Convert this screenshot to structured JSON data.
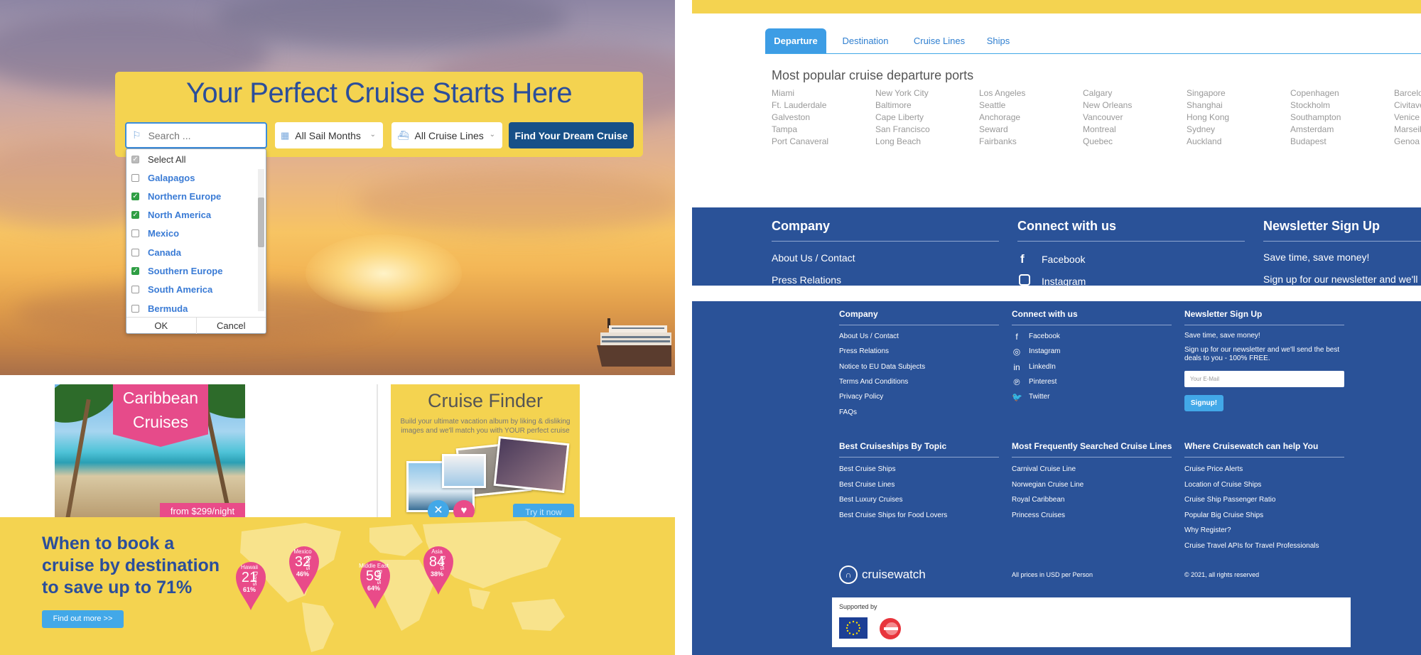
{
  "hero": {
    "title": "Your Perfect Cruise Starts Here",
    "search_placeholder": "Search ...",
    "months_label": "All Sail Months",
    "lines_label": "All Cruise Lines",
    "find_button": "Find Your Dream Cruise"
  },
  "dropdown": {
    "select_all": "Select All",
    "items": [
      {
        "label": "Galapagos",
        "checked": false
      },
      {
        "label": "Northern Europe",
        "checked": true
      },
      {
        "label": "North America",
        "checked": true
      },
      {
        "label": "Mexico",
        "checked": false
      },
      {
        "label": "Canada",
        "checked": false
      },
      {
        "label": "Southern Europe",
        "checked": true
      },
      {
        "label": "South America",
        "checked": false
      },
      {
        "label": "Bermuda",
        "checked": false
      }
    ],
    "ok": "OK",
    "cancel": "Cancel"
  },
  "caribbean": {
    "title_line1": "Caribbean",
    "title_line2": "Cruises",
    "price": "from   $299/night"
  },
  "finder": {
    "title": "Cruise Finder",
    "desc": "Build your ultimate vacation album by liking & disliking images and we'll match you with YOUR perfect cruise",
    "try_label": "Try it now"
  },
  "when": {
    "title": "When to book a cruise by destination to save up to 71%",
    "button": "Find out more >>",
    "days_label": "Days",
    "pins": [
      {
        "name": "Hawaii",
        "days": "21",
        "pct": "61%"
      },
      {
        "name": "Mexico",
        "days": "32",
        "pct": "46%"
      },
      {
        "name": "Middle East",
        "days": "59",
        "pct": "64%"
      },
      {
        "name": "Asia",
        "days": "84",
        "pct": "38%"
      }
    ]
  },
  "tabs": [
    "Departure",
    "Destination",
    "Cruise Lines",
    "Ships"
  ],
  "ports": {
    "title": "Most popular cruise departure ports",
    "columns": [
      [
        "Miami",
        "Ft. Lauderdale",
        "Galveston",
        "Tampa",
        "Port Canaveral"
      ],
      [
        "New York City",
        "Baltimore",
        "Cape Liberty",
        "San Francisco",
        "Long Beach"
      ],
      [
        "Los Angeles",
        "Seattle",
        "Anchorage",
        "Seward",
        "Fairbanks"
      ],
      [
        "Calgary",
        "New Orleans",
        "Vancouver",
        "Montreal",
        "Quebec"
      ],
      [
        "Singapore",
        "Shanghai",
        "Hong Kong",
        "Sydney",
        "Auckland"
      ],
      [
        "Copenhagen",
        "Stockholm",
        "Southampton",
        "Amsterdam",
        "Budapest"
      ],
      [
        "Barcelona",
        "Civitavecchia",
        "Venice",
        "Marseille",
        "Genoa &"
      ]
    ]
  },
  "footer_top": {
    "company": "Company",
    "connect": "Connect with us",
    "newsletter": "Newsletter Sign Up",
    "about": "About Us / Contact",
    "press": "Press Relations",
    "facebook": "Facebook",
    "instagram": "Instagram",
    "save": "Save time, save money!",
    "signup_text": "Sign up for our newsletter and we'll"
  },
  "footer": {
    "company_head": "Company",
    "company_links": [
      "About Us / Contact",
      "Press Relations",
      "Notice to EU Data Subjects",
      "Terms And Conditions",
      "Privacy Policy",
      "FAQs"
    ],
    "connect_head": "Connect with us",
    "social": [
      "Facebook",
      "Instagram",
      "LinkedIn",
      "Pinterest",
      "Twitter"
    ],
    "newsletter_head": "Newsletter Sign Up",
    "newsletter_save": "Save time, save money!",
    "newsletter_desc": "Sign up for our newsletter and we'll send the best deals to you - 100% FREE.",
    "email_placeholder": "Your E-Mail",
    "signup": "Signup!",
    "topic_head": "Best Cruiseships By Topic",
    "topic_links": [
      "Best Cruise Ships",
      "Best Cruise Lines",
      "Best Luxury Cruises",
      "Best Cruise Ships for Food Lovers"
    ],
    "searched_head": "Most Frequently Searched Cruise Lines",
    "searched_links": [
      "Carnival Cruise Line",
      "Norwegian Cruise Line",
      "Royal Caribbean",
      "Princess Cruises"
    ],
    "help_head": "Where Cruisewatch can help You",
    "help_links": [
      "Cruise Price Alerts",
      "Location of Cruise Ships",
      "Cruise Ship Passenger Ratio",
      "Popular Big Cruise Ships",
      "Why Register?",
      "Cruise Travel APIs for Travel Professionals"
    ],
    "logo": "cruisewatch",
    "prices_note": "All prices in USD per Person",
    "copyright": "© 2021, all rights reserved",
    "supported_by": "Supported by"
  },
  "colors": {
    "brand_yellow": "#f4d350",
    "brand_blue": "#2a5298",
    "title_blue": "#2b4e9b",
    "accent_blue": "#42a8e8",
    "pink": "#e94b89",
    "dark_button": "#175088"
  }
}
